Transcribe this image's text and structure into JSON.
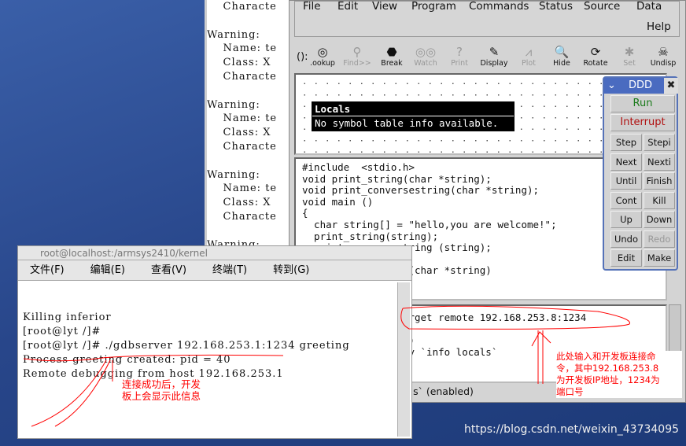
{
  "warning_window": {
    "lines": [
      "    Characte",
      "",
      "Warning:",
      "    Name: te",
      "    Class: X",
      "    Characte",
      "",
      "Warning:",
      "    Name: te",
      "    Class: X",
      "    Characte",
      "",
      "Warning:",
      "    Name: te",
      "    Class: X",
      "    Characte",
      "",
      "Warning:"
    ]
  },
  "ddd": {
    "menu": [
      "File",
      "Edit",
      "View",
      "Program",
      "Commands",
      "Status",
      "Source",
      "Data",
      "Help"
    ],
    "toolbar": {
      "arg_label": "():",
      "buttons": [
        {
          "label": ".ookup",
          "icon": "lookup-icon",
          "enabled": true
        },
        {
          "label": "Find>>",
          "icon": "find-icon",
          "enabled": false
        },
        {
          "label": "Break",
          "icon": "stop-icon",
          "enabled": true
        },
        {
          "label": "Watch",
          "icon": "watch-icon",
          "enabled": false
        },
        {
          "label": "Print",
          "icon": "print-icon",
          "enabled": false
        },
        {
          "label": "Display",
          "icon": "display-icon",
          "enabled": true
        },
        {
          "label": "Plot",
          "icon": "plot-icon",
          "enabled": false
        },
        {
          "label": "Hide",
          "icon": "hide-icon",
          "enabled": true
        },
        {
          "label": "Rotate",
          "icon": "rotate-icon",
          "enabled": true
        },
        {
          "label": "Set",
          "icon": "set-icon",
          "enabled": false
        },
        {
          "label": "Undisp",
          "icon": "undisp-icon",
          "enabled": true
        }
      ]
    },
    "locals": {
      "title": "Locals",
      "value": "No symbol table info available."
    },
    "source": "#include  <stdio.h>\nvoid print_string(char *string);\nvoid print_conversestring(char *string);\nvoid main ()\n{\n  char string[] = \"hello,you are welcome!\";\n  print_string(string);\n  print_conversestring (string);\n}\nvoid print_string (char *string)\n{",
    "console": "Copyright (gdb) target remote 192.168.253.8:1234\n\n0x40002a50 in ?? ()\n(gdb) graph display `info locals`\n(gdb)",
    "status": "Display -1: `info locals` (enabled)",
    "command_tool": {
      "title": "DDD",
      "run": "Run",
      "interrupt": "Interrupt",
      "buttons": [
        "Step",
        "Stepi",
        "Next",
        "Nexti",
        "Until",
        "Finish",
        "Cont",
        "Kill",
        "Up",
        "Down",
        "Undo",
        "Redo",
        "Edit",
        "Make"
      ]
    }
  },
  "terminal": {
    "title": "root@localhost:/armsys2410/kernel",
    "menu": [
      "文件(F)",
      "编辑(E)",
      "查看(V)",
      "终端(T)",
      "转到(G)"
    ],
    "lines": [
      "Killing inferior",
      "[root@lyt /]#",
      "[root@lyt /]# ./gdbserver 192.168.253.1:1234 greeting",
      "Process greeting created: pid = 40",
      "Remote debugging from host 192.168.253.1"
    ]
  },
  "annotations": {
    "left": "连接成功后，开发\n板上会显示此信息",
    "right": "此处输入和开发板连接命\n令，其中192.168.253.8\n为开发板IP地址，1234为\n端口号"
  },
  "watermark": "https://blog.csdn.net/weixin_43734095",
  "colors": {
    "annotation": "#ff0000",
    "run": "#1a7a1a",
    "interrupt": "#b01010",
    "desktop": "#2b4a8a"
  }
}
